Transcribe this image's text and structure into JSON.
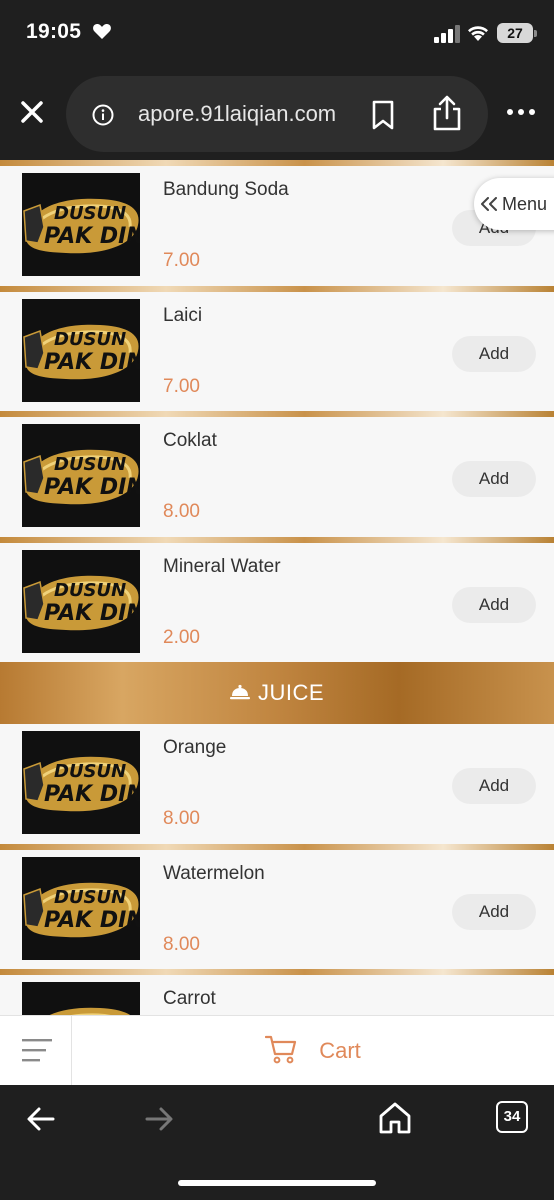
{
  "status_bar": {
    "time": "19:05",
    "battery": "27"
  },
  "browser": {
    "url": "apore.91laiqian.com"
  },
  "floating_menu": {
    "label": "Menu"
  },
  "menu": {
    "logo_text": [
      "DUSUN",
      "PAK DIN"
    ],
    "items_top": [
      {
        "name": "Bandung Soda",
        "price": "7.00",
        "add": "Add"
      },
      {
        "name": "Laici",
        "price": "7.00",
        "add": "Add"
      },
      {
        "name": "Coklat",
        "price": "8.00",
        "add": "Add"
      },
      {
        "name": "Mineral Water",
        "price": "2.00",
        "add": "Add"
      }
    ],
    "category": "JUICE",
    "items_juice": [
      {
        "name": "Orange",
        "price": "8.00",
        "add": "Add"
      },
      {
        "name": "Watermelon",
        "price": "8.00",
        "add": "Add"
      },
      {
        "name": "Carrot",
        "price": "",
        "add": ""
      }
    ]
  },
  "cart": {
    "label": "Cart"
  },
  "toolbar": {
    "tab_count": "34"
  },
  "colors": {
    "accent": "#e0895a",
    "gold": "#c48a3c",
    "dark": "#1f1f1f"
  }
}
